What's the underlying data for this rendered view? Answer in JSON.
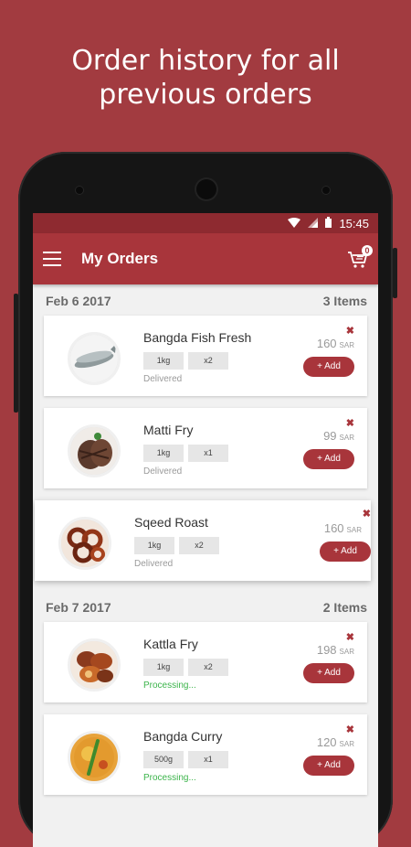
{
  "promo": {
    "line1": "Order history for all",
    "line2": "previous orders"
  },
  "statusbar": {
    "time": "15:45"
  },
  "appbar": {
    "title": "My Orders",
    "cart_count": "0"
  },
  "colors": {
    "background": "#a23b40",
    "accent": "#a8353b",
    "statusbar": "#8e2a30",
    "processing": "#3cb44b"
  },
  "groups": [
    {
      "date": "Feb 6 2017",
      "count_label": "3 Items",
      "items": [
        {
          "name": "Bangda Fish Fresh",
          "qty": "1kg",
          "mult": "x2",
          "status": "Delivered",
          "price": "160",
          "currency": "SAR",
          "add_label": "+ Add",
          "remove_icon": "close-icon"
        },
        {
          "name": "Matti Fry",
          "qty": "1kg",
          "mult": "x1",
          "status": "Delivered",
          "price": "99",
          "currency": "SAR",
          "add_label": "+ Add",
          "remove_icon": "close-icon"
        },
        {
          "name": "Sqeed Roast",
          "qty": "1kg",
          "mult": "x2",
          "status": "Delivered",
          "price": "160",
          "currency": "SAR",
          "add_label": "+ Add",
          "remove_icon": "close-icon"
        }
      ]
    },
    {
      "date": "Feb 7 2017",
      "count_label": "2 Items",
      "items": [
        {
          "name": "Kattla Fry",
          "qty": "1kg",
          "mult": "x2",
          "status": "Processing...",
          "price": "198",
          "currency": "SAR",
          "add_label": "+ Add",
          "remove_icon": "close-icon"
        },
        {
          "name": "Bangda Curry",
          "qty": "500g",
          "mult": "x1",
          "status": "Processing...",
          "price": "120",
          "currency": "SAR",
          "add_label": "+ Add",
          "remove_icon": "close-icon"
        }
      ]
    }
  ]
}
